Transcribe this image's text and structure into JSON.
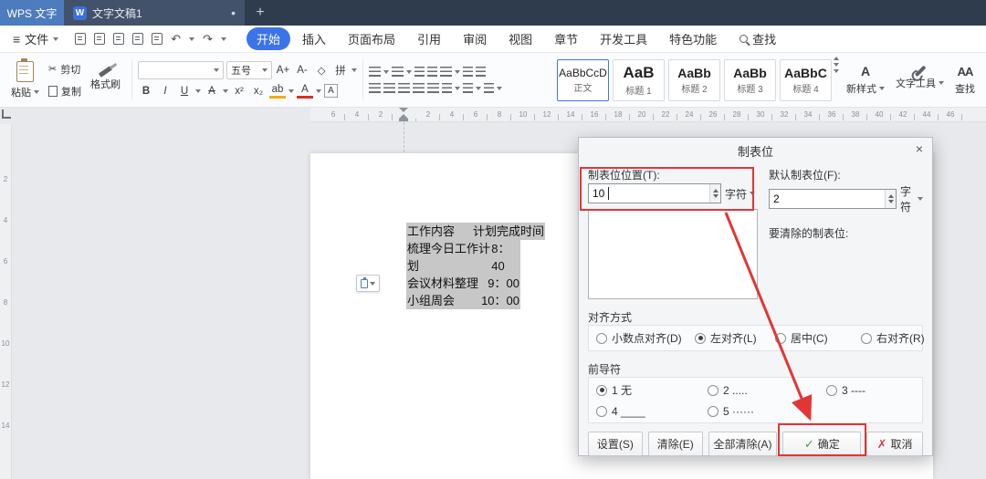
{
  "colors": {
    "titlebar_bg": "#2e3c4d",
    "app_tab_blue": "#4d7cbe",
    "doc_tab_bg": "#41526a",
    "active_tab_pill": "#3b73e8",
    "annotation_red": "#e23636",
    "selection_gray": "#c7c7c7",
    "ok_check_green": "#43a047",
    "cancel_x_red": "#d2413a"
  },
  "titlebar": {
    "app_tab": "WPS 文字",
    "doc_tab": "文字文稿1",
    "unsaved_dot": "•",
    "new_tab": "+"
  },
  "menubar": {
    "file_label": "文件",
    "tabs": [
      {
        "label": "开始",
        "active": true
      },
      {
        "label": "插入"
      },
      {
        "label": "页面布局"
      },
      {
        "label": "引用"
      },
      {
        "label": "审阅"
      },
      {
        "label": "视图"
      },
      {
        "label": "章节"
      },
      {
        "label": "开发工具"
      },
      {
        "label": "特色功能"
      }
    ],
    "find_label": "查找"
  },
  "icons": {
    "hamburger": "≡",
    "w_logo": "W",
    "scissors": "✂",
    "undo": "↶",
    "redo": "↷",
    "bold": "B",
    "italic": "I",
    "underline": "U",
    "strikethrough": "A",
    "superscript": "x²",
    "subscript": "x₂",
    "font_color": "A",
    "highlight": "ab",
    "character_border": "A",
    "clear_format": "◇",
    "pinyin_guide": "拼",
    "grow_font": "A+",
    "shrink_font": "A-",
    "check": "✓",
    "cross": "✗",
    "new_style_glyph": "A",
    "find_tool_glyph": "AA"
  },
  "ribbon": {
    "paste_label": "粘贴",
    "cut_label": "剪切",
    "copy_label": "复制",
    "format_painter_label": "格式刷",
    "font_name_value": "",
    "font_size_value": "五号",
    "styles": [
      {
        "sample": "AaBbCcD",
        "name": "正文",
        "selected": true
      },
      {
        "sample": "AaB",
        "name": "标题 1"
      },
      {
        "sample": "AaBb",
        "name": "标题 2"
      },
      {
        "sample": "AaBb",
        "name": "标题 3"
      },
      {
        "sample": "AaBbC",
        "name": "标题 4"
      }
    ],
    "new_style_label": "新样式",
    "text_tool_label": "文字工具",
    "find_tool_label": "查找"
  },
  "ruler": {
    "h_numbers": [
      "6",
      "4",
      "2",
      "",
      "2",
      "4",
      "6",
      "8",
      "10",
      "12",
      "14",
      "16",
      "18",
      "20",
      "22",
      "24",
      "26",
      "28",
      "30",
      "32",
      "34",
      "36",
      "38",
      "40",
      "42",
      "44",
      "46"
    ],
    "v_numbers": [
      "2",
      "4",
      "6",
      "8",
      "10",
      "12",
      "14"
    ]
  },
  "document": {
    "lines": [
      {
        "left": "工作内容",
        "right": "计划完成时间"
      },
      {
        "left": "梳理今日工作计划",
        "right": "8：40"
      },
      {
        "left": "会议材料整理",
        "right": "9：00"
      },
      {
        "left": "小组周会",
        "right": "10：00"
      }
    ]
  },
  "dialog": {
    "title": "制表位",
    "close": "×",
    "tab_position_label": "制表位位置(T):",
    "tab_position_value": "10",
    "tab_position_unit": "字符",
    "default_tab_label": "默认制表位(F):",
    "default_tab_value": "2",
    "default_tab_unit": "字符",
    "clear_list_label": "要清除的制表位:",
    "alignment_label": "对齐方式",
    "alignment_options": [
      {
        "label": "小数点对齐(D)"
      },
      {
        "label": "左对齐(L)",
        "checked": true
      },
      {
        "label": "居中(C)"
      },
      {
        "label": "右对齐(R)"
      }
    ],
    "leader_label": "前导符",
    "leader_options": [
      {
        "label": "1 无",
        "checked": true
      },
      {
        "label": "2 ....."
      },
      {
        "label": "3 ----"
      },
      {
        "label": "4 ____"
      },
      {
        "label": "5 ······"
      }
    ],
    "buttons": {
      "set": "设置(S)",
      "clear": "清除(E)",
      "clear_all": "全部清除(A)",
      "ok": "确定",
      "cancel": "取消"
    }
  }
}
